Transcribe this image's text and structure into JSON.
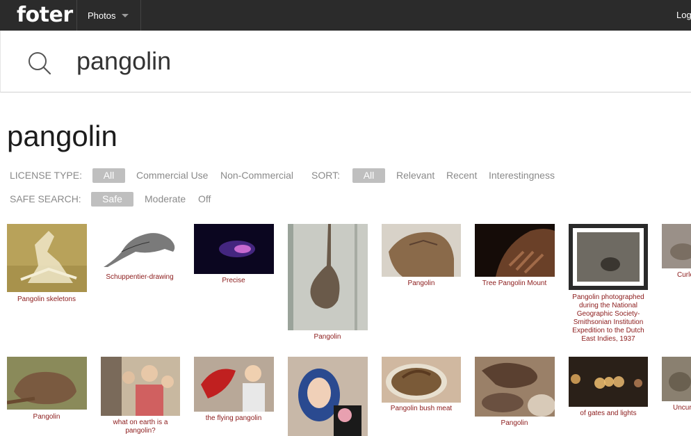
{
  "header": {
    "logo": "foter",
    "nav_photos": "Photos",
    "login": "Log"
  },
  "search": {
    "query": "pangolin"
  },
  "page": {
    "title": "pangolin"
  },
  "filters": {
    "license_label": "LICENSE TYPE:",
    "license_options": [
      "All",
      "Commercial Use",
      "Non-Commercial"
    ],
    "sort_label": "SORT:",
    "sort_options": [
      "All",
      "Relevant",
      "Recent",
      "Interestingness"
    ],
    "safe_label": "SAFE SEARCH:",
    "safe_options": [
      "Safe",
      "Moderate",
      "Off"
    ]
  },
  "photos_row1": [
    {
      "caption": "Pangolin skeletons"
    },
    {
      "caption": "Schuppentier-drawing"
    },
    {
      "caption": "Precise"
    },
    {
      "caption": "Pangolin"
    },
    {
      "caption": "Pangolin"
    },
    {
      "caption": "Tree Pangolin Mount"
    },
    {
      "caption": "Pangolin photographed during the National Geographic Society-Smithsonian Institution Expedition to the Dutch East Indies, 1937"
    },
    {
      "caption": "Curle"
    }
  ],
  "photos_row2": [
    {
      "caption": "Pangolin"
    },
    {
      "caption": "what on earth is a pangolin?"
    },
    {
      "caption": "the flying pangolin"
    },
    {
      "caption": ""
    },
    {
      "caption": "Pangolin bush meat"
    },
    {
      "caption": "Pangolin"
    },
    {
      "caption": "of gates and lights"
    },
    {
      "caption": "Uncur"
    }
  ],
  "icons": [
    "search-icon",
    "chevron-down-icon"
  ],
  "colors": {
    "topbar": "#2b2b2b",
    "pill": "#bfbfbf",
    "caption": "#8b1a1a"
  }
}
